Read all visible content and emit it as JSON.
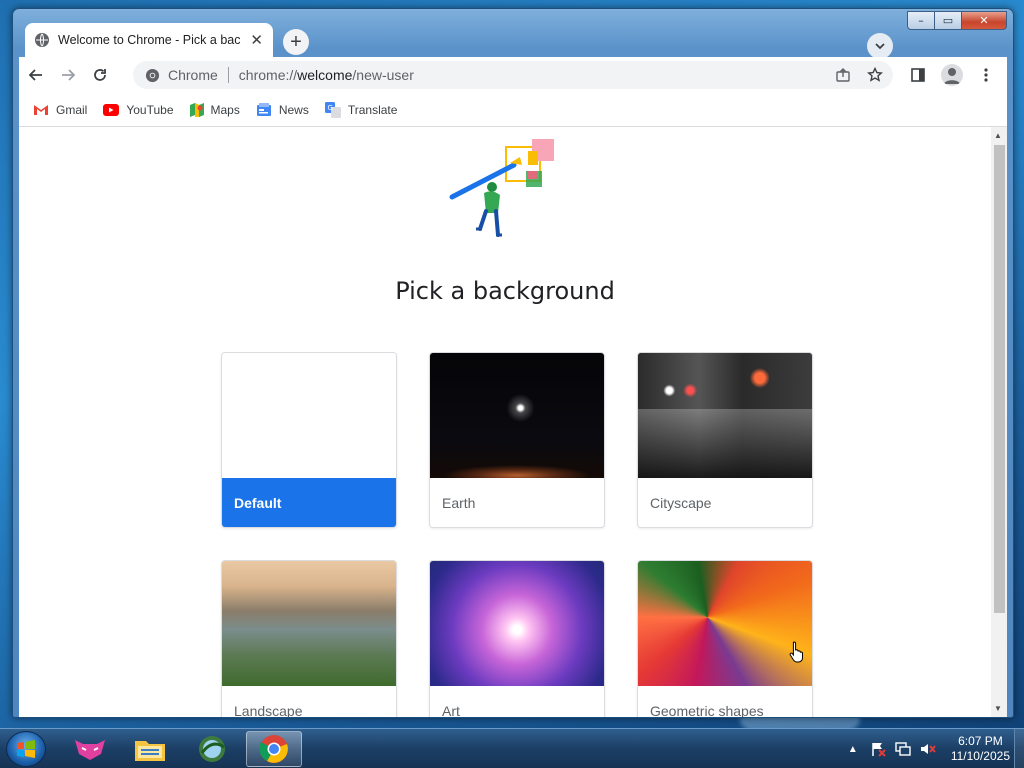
{
  "window": {
    "minimize": "–",
    "maximize": "▭",
    "close": "✕"
  },
  "tabs": [
    {
      "title": "Welcome to Chrome - Pick a bac",
      "close": "✕"
    }
  ],
  "new_tab": "+",
  "tab_search": "⌄",
  "omnibox": {
    "site_label": "Chrome",
    "url_scheme": "chrome://",
    "url_host": "welcome",
    "url_path": "/new-user"
  },
  "bookmarks": [
    {
      "label": "Gmail",
      "icon": "gmail-icon"
    },
    {
      "label": "YouTube",
      "icon": "youtube-icon"
    },
    {
      "label": "Maps",
      "icon": "maps-icon"
    },
    {
      "label": "News",
      "icon": "news-icon"
    },
    {
      "label": "Translate",
      "icon": "translate-icon"
    }
  ],
  "page": {
    "heading": "Pick a background",
    "backgrounds": [
      {
        "label": "Default",
        "selected": true
      },
      {
        "label": "Earth",
        "selected": false
      },
      {
        "label": "Cityscape",
        "selected": false
      },
      {
        "label": "Landscape",
        "selected": false
      },
      {
        "label": "Art",
        "selected": false
      },
      {
        "label": "Geometric shapes",
        "selected": false
      }
    ]
  },
  "colors": {
    "accent": "#1a73e8",
    "selected_label_text": "#ffffff",
    "card_label_text": "#5f6368"
  },
  "taskbar": {
    "clock_time": "6:07 PM",
    "clock_date": "11/10/2025",
    "items": [
      "fox-app-icon",
      "file-explorer-icon",
      "network-app-icon",
      "chrome-icon"
    ]
  }
}
